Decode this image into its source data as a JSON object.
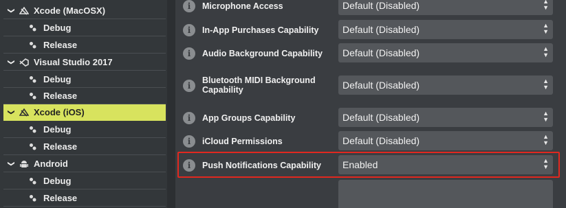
{
  "tree": [
    {
      "label": "Xcode (MacOSX)",
      "kind": "parent",
      "icon": "xcode-icon",
      "chevron": "chevron-down-icon"
    },
    {
      "label": "Debug",
      "kind": "child",
      "icon": "config-icon"
    },
    {
      "label": "Release",
      "kind": "child",
      "icon": "config-icon"
    },
    {
      "label": "Visual Studio 2017",
      "kind": "parent",
      "icon": "visual-studio-icon",
      "chevron": "chevron-down-icon"
    },
    {
      "label": "Debug",
      "kind": "child",
      "icon": "config-icon"
    },
    {
      "label": "Release",
      "kind": "child",
      "icon": "config-icon"
    },
    {
      "label": "Xcode (iOS)",
      "kind": "parent",
      "icon": "xcode-icon",
      "chevron": "chevron-down-icon",
      "selected": true
    },
    {
      "label": "Debug",
      "kind": "child",
      "icon": "config-icon"
    },
    {
      "label": "Release",
      "kind": "child",
      "icon": "config-icon"
    },
    {
      "label": "Android",
      "kind": "parent",
      "icon": "android-icon",
      "chevron": "chevron-down-icon"
    },
    {
      "label": "Debug",
      "kind": "child",
      "icon": "config-icon"
    },
    {
      "label": "Release",
      "kind": "child",
      "icon": "config-icon"
    }
  ],
  "settings": [
    {
      "label": "Microphone Access",
      "value": "Default (Disabled)"
    },
    {
      "label": "In-App Purchases Capability",
      "value": "Default (Disabled)"
    },
    {
      "label": "Audio Background Capability",
      "value": "Default (Disabled)"
    },
    {
      "label": "Bluetooth MIDI Background Capability",
      "value": "Default (Disabled)"
    },
    {
      "label": "App Groups Capability",
      "value": "Default (Disabled)"
    },
    {
      "label": "iCloud Permissions",
      "value": "Default (Disabled)"
    },
    {
      "label": "Push Notifications Capability",
      "value": "Enabled",
      "highlighted": true
    }
  ],
  "colors": {
    "selected_bg": "#d8e35e",
    "highlight_border": "#e2281f"
  }
}
